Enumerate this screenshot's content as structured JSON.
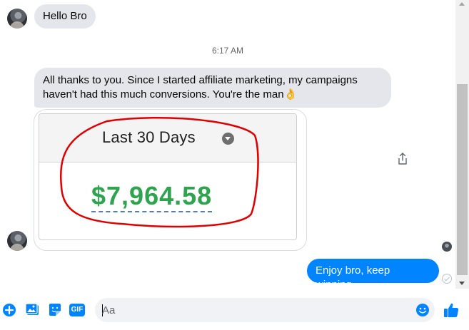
{
  "conversation": {
    "messages": [
      {
        "sender": "contact",
        "text": "Hello Bro"
      },
      {
        "sender": "contact",
        "text": "All thanks to you. Since I started affiliate marketing, my campaigns haven't had this much conversions. You're the man👌"
      },
      {
        "sender": "me",
        "text": "Enjoy bro, keep winning."
      }
    ],
    "timestamp": "6:17 AM",
    "attachment": {
      "period_label": "Last 30 Days",
      "amount": "$7,964.58",
      "amount_color": "#2ea44f",
      "annotation_color": "#e00000"
    }
  },
  "composer": {
    "placeholder": "Aa",
    "tools": [
      "plus-icon",
      "photo-icon",
      "sticker-icon",
      "gif-icon"
    ],
    "gif_label": "GIF",
    "accent_color": "#0084ff"
  }
}
